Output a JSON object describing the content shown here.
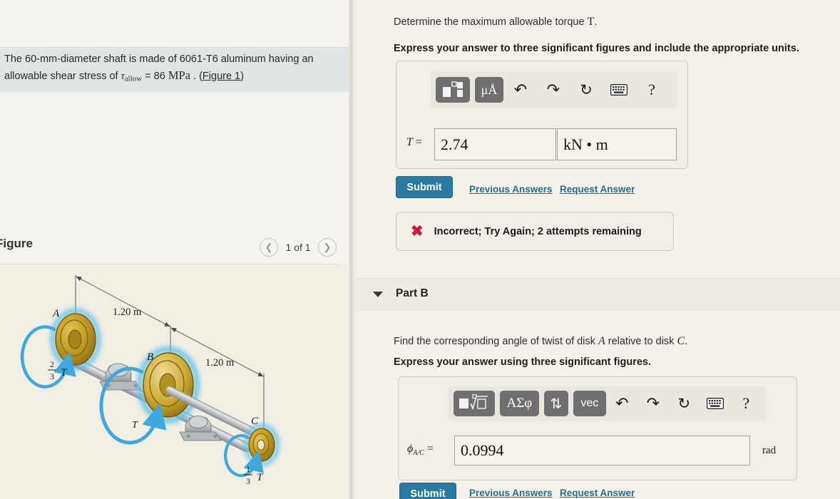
{
  "problem": {
    "text_before_var": "The 60-mm-diameter shaft is made of 6061-T6 aluminum having an allowable shear stress of ",
    "tau_symbol": "τ",
    "tau_subscript": "allow",
    "equals_value": " = 86 ",
    "unit": "MPa",
    "period": " . (",
    "figure_link": "Figure 1",
    "close_paren": ")"
  },
  "figure": {
    "title": "Figure",
    "count_label": "1 of 1",
    "prev_icon": "chevron-left-icon",
    "next_icon": "chevron-right-icon",
    "labels": {
      "disk_a": "A",
      "disk_b": "B",
      "disk_c": "C",
      "dim_1": "1.20 m",
      "dim_2": "1.20 m",
      "torque_a_num": "2",
      "torque_a_den": "3",
      "torque_a_sym": "T",
      "torque_b_sym": "T",
      "torque_c_num": "1",
      "torque_c_den": "3",
      "torque_c_sym": "T"
    },
    "colors": {
      "disk_gold": "#c9a227",
      "disk_gold_dark": "#9c7c18",
      "torque_blue": "#4fb8e8",
      "shaft_grey": "#b9bcbe",
      "paper": "#f1eee4"
    }
  },
  "part_a": {
    "prompt_text": "Determine the maximum allowable torque ",
    "prompt_var": "T",
    "prompt_end": ".",
    "instruction": "Express your answer to three significant figures and include the appropriate units.",
    "toolbar": [
      {
        "name": "template-button",
        "glyph": "■⬚",
        "style": "dark"
      },
      {
        "name": "units-button",
        "glyph": "μÅ",
        "style": "dark"
      },
      {
        "name": "undo-button",
        "glyph": "↶",
        "style": "plain"
      },
      {
        "name": "redo-button",
        "glyph": "↷",
        "style": "plain"
      },
      {
        "name": "reset-button",
        "glyph": "↻",
        "style": "plain"
      },
      {
        "name": "keyboard-button",
        "glyph": "⌨",
        "style": "plain"
      },
      {
        "name": "help-button",
        "glyph": "?",
        "style": "plain"
      }
    ],
    "field_label": "T",
    "field_label_sub": "",
    "field_equals": "=",
    "value": "2.74",
    "units": "kN • m",
    "submit_label": "Submit",
    "previous_answers_label": "Previous Answers",
    "request_answer_label": "Request Answer",
    "feedback_icon": "cross-icon",
    "feedback_text": "Incorrect; Try Again; 2 attempts remaining"
  },
  "part_b": {
    "header_label": "Part B",
    "caret_icon": "caret-down-icon",
    "prompt_text_1": "Find the corresponding angle of twist of disk ",
    "prompt_var_1": "A",
    "prompt_text_2": " relative to disk ",
    "prompt_var_2": "C",
    "prompt_end": ".",
    "instruction": "Express your answer using three significant figures.",
    "toolbar": [
      {
        "name": "template-radical-button",
        "glyph": "■√⬚",
        "style": "dark"
      },
      {
        "name": "greek-button",
        "glyph": "ΑΣφ",
        "style": "dark"
      },
      {
        "name": "arrows-button",
        "glyph": "⇅",
        "style": "dark"
      },
      {
        "name": "vector-button",
        "glyph": "vec",
        "style": "dark"
      },
      {
        "name": "undo-button",
        "glyph": "↶",
        "style": "plain"
      },
      {
        "name": "redo-button",
        "glyph": "↷",
        "style": "plain"
      },
      {
        "name": "reset-button",
        "glyph": "↻",
        "style": "plain"
      },
      {
        "name": "keyboard-button",
        "glyph": "⌨",
        "style": "plain"
      },
      {
        "name": "help-button",
        "glyph": "?",
        "style": "plain"
      }
    ],
    "field_label": "ϕ",
    "field_label_sub": "A/C",
    "field_equals": "=",
    "value": "0.0994",
    "units": "rad",
    "submit_label": "Submit",
    "previous_answers_label": "Previous Answers",
    "request_answer_label": "Request Answer"
  },
  "theme": {
    "accent_blue": "#2a7ba3",
    "link_blue": "#1f6f95",
    "error_red": "#cf1b3b",
    "highlight_band": "#dfe5e3",
    "page_bg": "#f3f1ea"
  }
}
